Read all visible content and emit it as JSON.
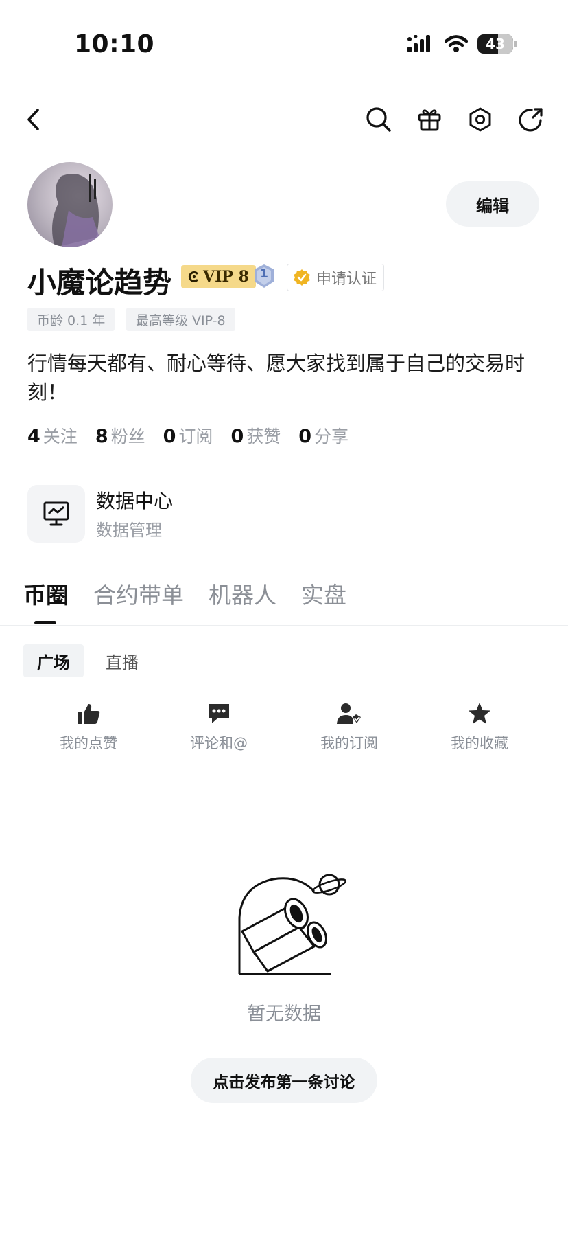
{
  "status_bar": {
    "time": "10:10",
    "battery": "43"
  },
  "profile": {
    "username": "小魔论趋势",
    "vip_label": "VIP 8",
    "level": "1",
    "verify_label": "申请认证",
    "edit_label": "编辑",
    "tags": [
      "币龄 0.1 年",
      "最高等级 VIP-8"
    ],
    "bio": "行情每天都有、耐心等待、愿大家找到属于自己的交易时刻！"
  },
  "stats": [
    {
      "value": "4",
      "label": "关注"
    },
    {
      "value": "8",
      "label": "粉丝"
    },
    {
      "value": "0",
      "label": "订阅"
    },
    {
      "value": "0",
      "label": "获赞"
    },
    {
      "value": "0",
      "label": "分享"
    }
  ],
  "data_center": {
    "title": "数据中心",
    "subtitle": "数据管理"
  },
  "tabs": [
    {
      "label": "币圈"
    },
    {
      "label": "合约带单"
    },
    {
      "label": "机器人"
    },
    {
      "label": "实盘"
    }
  ],
  "subtabs": [
    {
      "label": "广场"
    },
    {
      "label": "直播"
    }
  ],
  "actions": [
    {
      "label": "我的点赞",
      "icon": "thumbs-up-icon"
    },
    {
      "label": "评论和@",
      "icon": "comment-icon"
    },
    {
      "label": "我的订阅",
      "icon": "user-check-icon"
    },
    {
      "label": "我的收藏",
      "icon": "star-icon"
    }
  ],
  "empty_state": {
    "text": "暂无数据",
    "button": "点击发布第一条讨论"
  }
}
